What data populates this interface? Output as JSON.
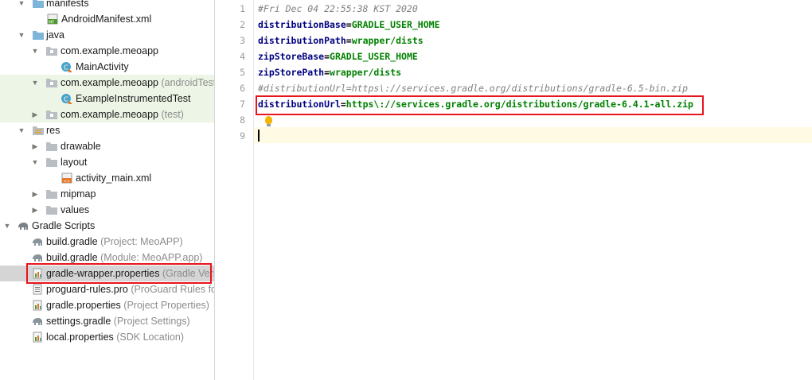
{
  "project_tree": {
    "items": [
      {
        "label": "manifests",
        "hint": "",
        "icon": "folder-icon"
      },
      {
        "label": "AndroidManifest.xml",
        "hint": "",
        "icon": "manifest-file-icon"
      },
      {
        "label": "java",
        "hint": "",
        "icon": "folder-icon"
      },
      {
        "label": "com.example.meoapp",
        "hint": "",
        "icon": "package-icon"
      },
      {
        "label": "MainActivity",
        "hint": "",
        "icon": "kotlin-class-icon"
      },
      {
        "label": "com.example.meoapp",
        "hint": "(androidTest)",
        "icon": "package-icon"
      },
      {
        "label": "ExampleInstrumentedTest",
        "hint": "",
        "icon": "kotlin-class-icon"
      },
      {
        "label": "com.example.meoapp",
        "hint": "(test)",
        "icon": "package-icon"
      },
      {
        "label": "res",
        "hint": "",
        "icon": "res-folder-icon"
      },
      {
        "label": "drawable",
        "hint": "",
        "icon": "folder-icon"
      },
      {
        "label": "layout",
        "hint": "",
        "icon": "folder-icon"
      },
      {
        "label": "activity_main.xml",
        "hint": "",
        "icon": "layout-xml-icon"
      },
      {
        "label": "mipmap",
        "hint": "",
        "icon": "folder-icon"
      },
      {
        "label": "values",
        "hint": "",
        "icon": "folder-icon"
      },
      {
        "label": "Gradle Scripts",
        "hint": "",
        "icon": "gradle-elephant-icon"
      },
      {
        "label": "build.gradle",
        "hint": "(Project: MeoAPP)",
        "icon": "gradle-file-icon"
      },
      {
        "label": "build.gradle",
        "hint": "(Module: MeoAPP.app)",
        "icon": "gradle-file-icon"
      },
      {
        "label": "gradle-wrapper.properties",
        "hint": "(Gradle Versi",
        "icon": "properties-file-icon"
      },
      {
        "label": "proguard-rules.pro",
        "hint": "(ProGuard Rules for",
        "icon": "text-file-icon"
      },
      {
        "label": "gradle.properties",
        "hint": "(Project Properties)",
        "icon": "properties-file-icon"
      },
      {
        "label": "settings.gradle",
        "hint": "(Project Settings)",
        "icon": "gradle-file-icon"
      },
      {
        "label": "local.properties",
        "hint": "(SDK Location)",
        "icon": "properties-file-icon"
      }
    ]
  },
  "editor": {
    "line_numbers": [
      "1",
      "2",
      "3",
      "4",
      "5",
      "6",
      "7",
      "8",
      "9"
    ],
    "comment_line1": "#Fri Dec 04 22:55:38 KST 2020",
    "lines": [
      {
        "key": "distributionBase",
        "value": "GRADLE_USER_HOME"
      },
      {
        "key": "distributionPath",
        "value": "wrapper/dists"
      },
      {
        "key": "zipStoreBase",
        "value": "GRADLE_USER_HOME"
      },
      {
        "key": "zipStorePath",
        "value": "wrapper/dists"
      }
    ],
    "comment_line6": "#distributionUrl=https\\://services.gradle.org/distributions/gradle-6.5-bin.zip",
    "line7_key": "distributionUrl",
    "line7_value": "https\\://services.gradle.org/distributions/gradle-6.4.1-all.zip"
  },
  "colors": {
    "highlight_box": "#e8141e",
    "test_background": "#edf6e6",
    "selected_background": "#d5d5d5",
    "key_color": "#000080",
    "value_color": "#008000"
  }
}
